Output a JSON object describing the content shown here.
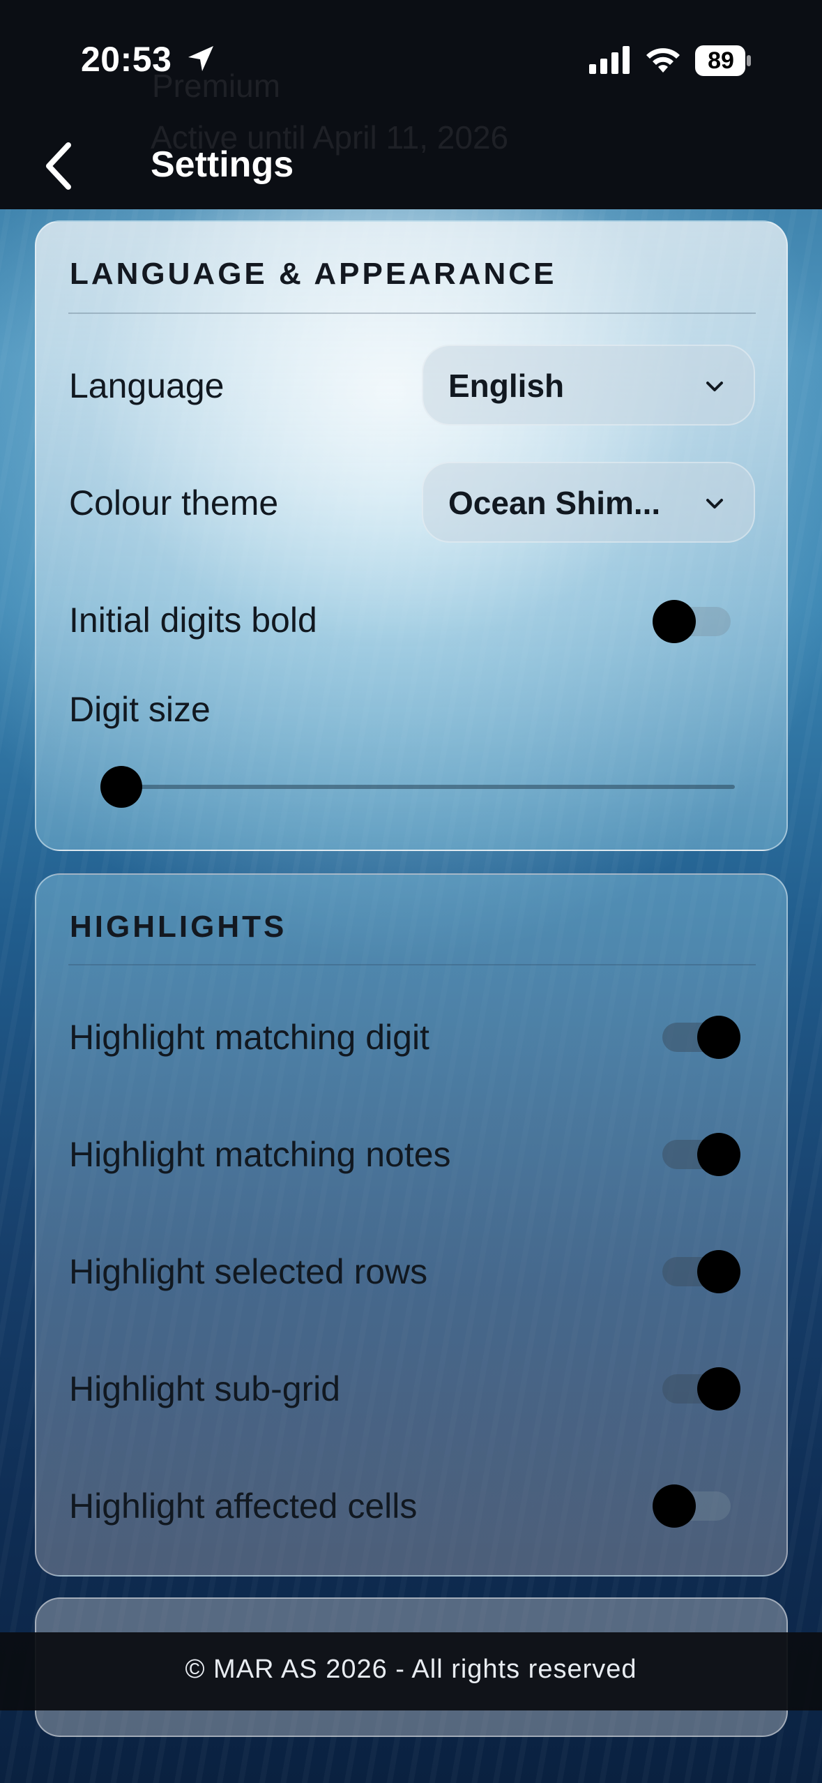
{
  "status_bar": {
    "time": "20:53",
    "battery": "89"
  },
  "header": {
    "title": "Settings",
    "ghost_title": "Premium",
    "ghost_subtitle": "Active until April 11, 2026"
  },
  "language_appearance": {
    "section_title": "LANGUAGE & APPEARANCE",
    "language_label": "Language",
    "language_value": "English",
    "theme_label": "Colour theme",
    "theme_value": "Ocean Shim...",
    "initial_bold_label": "Initial digits bold",
    "initial_bold_on": false,
    "digit_size_label": "Digit size",
    "digit_size_value": 0
  },
  "highlights": {
    "section_title": "HIGHLIGHTS",
    "items": [
      {
        "label": "Highlight matching digit",
        "on": true
      },
      {
        "label": "Highlight matching notes",
        "on": true
      },
      {
        "label": "Highlight selected rows",
        "on": true
      },
      {
        "label": "Highlight sub-grid",
        "on": true
      },
      {
        "label": "Highlight affected cells",
        "on": false
      }
    ]
  },
  "footer": {
    "copyright": "© MAR AS 2026 - All rights reserved"
  },
  "icons": {
    "location": "location-arrow-icon",
    "signal": "cellular-signal-icon",
    "wifi": "wifi-icon",
    "battery": "battery-icon",
    "back": "chevron-left-icon",
    "dropdown": "chevron-down-icon"
  }
}
